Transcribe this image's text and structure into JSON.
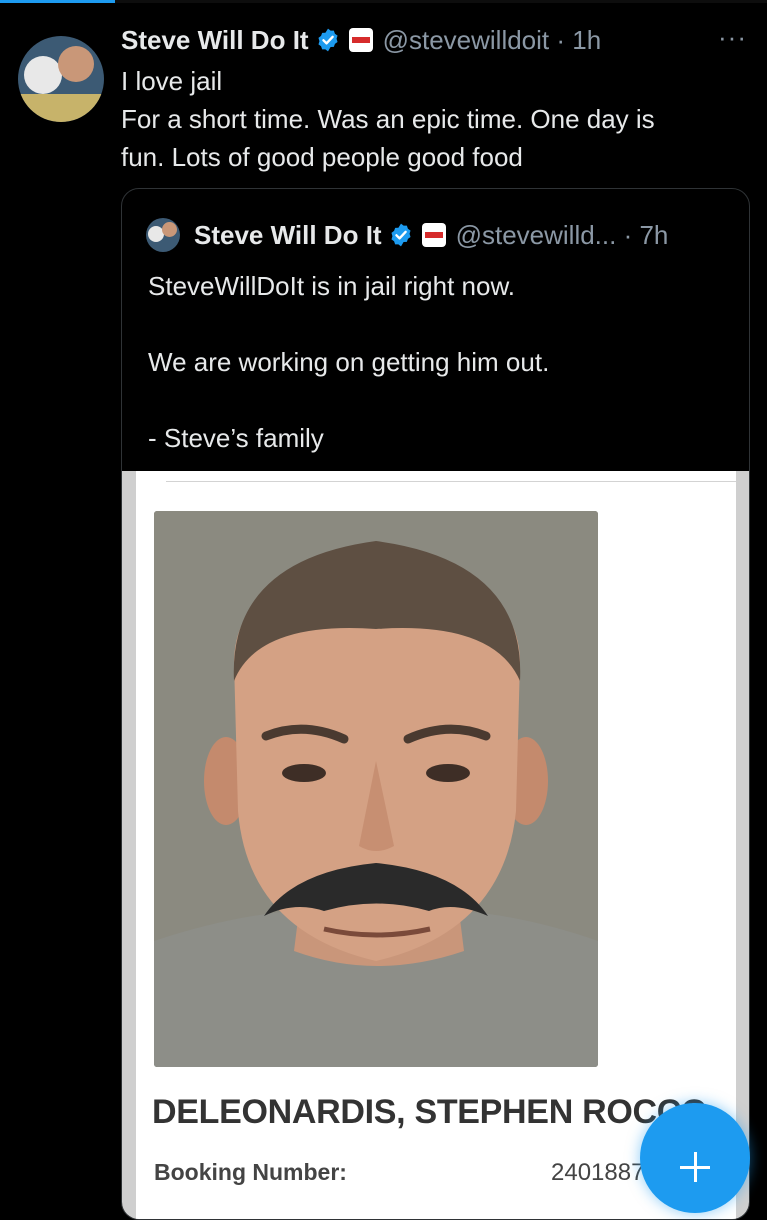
{
  "progress": {
    "fraction": 0.15
  },
  "tweet": {
    "author_name": "Steve Will Do It",
    "handle_time": "@stevewilldoit · 1h",
    "more": "···",
    "text_lines": [
      "I love jail",
      "For a short time. Was an epic time. One day is",
      "fun. Lots of good people good food"
    ]
  },
  "quote": {
    "author_name": "Steve Will Do It",
    "handle_time": "@stevewilld... · 7h",
    "text_lines": [
      "SteveWillDoIt is in jail right now.",
      "",
      "We are working on getting him out.",
      "",
      "- Steve’s family"
    ]
  },
  "booking": {
    "name": "DELEONARDIS, STEPHEN ROCCO",
    "label": "Booking Number:",
    "number": "24018871"
  },
  "colors": {
    "background": "#000000",
    "text": "#e7e9ea",
    "secondary": "#8b98a5",
    "accent": "#1d9bf0",
    "border": "#2f3336"
  },
  "icons": [
    "verified-badge-icon",
    "affiliate-badge-icon",
    "more-icon",
    "plus-icon"
  ]
}
